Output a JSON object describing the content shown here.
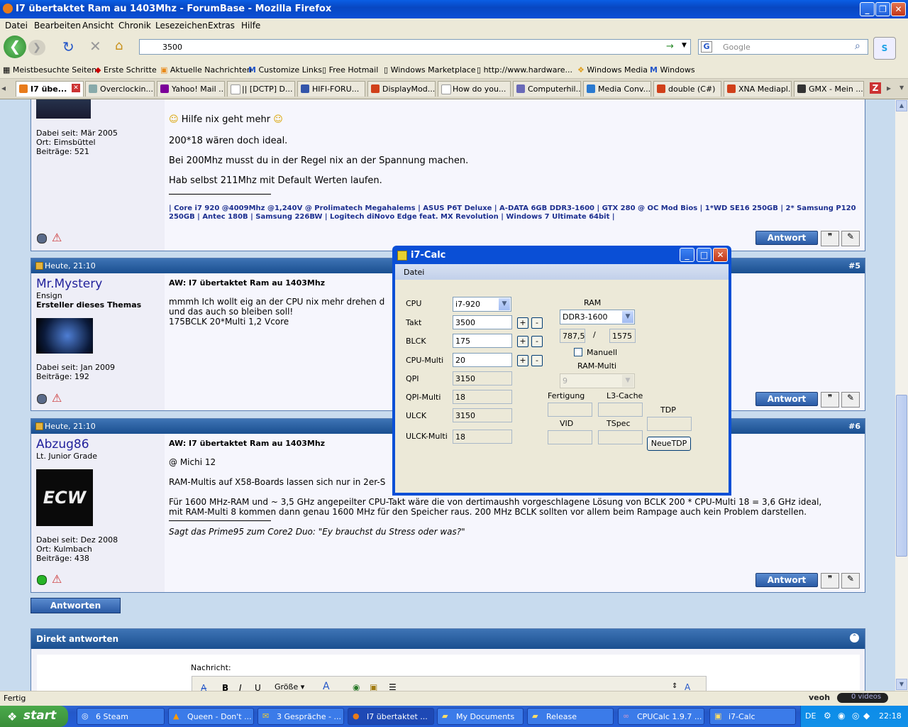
{
  "window": {
    "title": "I7 übertaktet Ram au 1403Mhz - ForumBase - Mozilla Firefox"
  },
  "menubar": [
    "Datei",
    "Bearbeiten",
    "Ansicht",
    "Chronik",
    "Lesezeichen",
    "Extras",
    "Hilfe"
  ],
  "nav": {
    "url": "3500",
    "search_placeholder": "Google"
  },
  "bookmarks": [
    "Meistbesuchte Seiten",
    "Erste Schritte",
    "Aktuelle Nachrichten",
    "Customize Links",
    "Free Hotmail",
    "Windows Marketplace",
    "http://www.hardware...",
    "Windows Media",
    "Windows"
  ],
  "tabs": [
    "I7 übe...",
    "Overclockin...",
    "Yahoo! Mail ...",
    "|| [DCTP] D...",
    "HIFI-FORU...",
    "DisplayMod...",
    "How do you...",
    "Computerhil...",
    "Media Conv...",
    "double (C#)",
    "XNA Mediapl...",
    "GMX - Mein ..."
  ],
  "post1": {
    "joined": "Dabei seit: Mär 2005",
    "location": "Ort: Eimsbüttel",
    "posts": "Beiträge: 521",
    "lines": [
      "Hilfe nix geht mehr",
      "200*18 wären doch ideal.",
      "Bei 200Mhz musst du in der Regel nix an der Spannung machen.",
      "Hab selbst 211Mhz mit Default Werten laufen."
    ],
    "signature": "| Core i7 920 @4009Mhz @1,240V @ Prolimatech Megahalems | ASUS P6T Deluxe | A-DATA 6GB DDR3-1600 | GTX 280 @ OC Mod Bios | 1*WD SE16 250GB | 2* Samsung P120 250GB | Antec 180B | Samsung 226BW | Logitech diNovo Edge feat. MX Revolution | Windows 7 Ultimate 64bit |"
  },
  "post2": {
    "date": "Heute, 21:10",
    "number": "#5",
    "user": "Mr.Mystery",
    "rank": "Ensign",
    "role": "Ersteller dieses Themas",
    "joined": "Dabei seit: Jan 2009",
    "posts": "Beiträge: 192",
    "subject": "AW: I7 übertaktet Ram au 1403Mhz",
    "lines": [
      "mmmh Ich wollt eig an der CPU nix mehr drehen d",
      "und das auch so bleiben soll!",
      "175BCLK 20*Multi 1,2 Vcore"
    ]
  },
  "post3": {
    "date": "Heute, 21:10",
    "number": "#6",
    "user": "Abzug86",
    "rank": "Lt. Junior Grade",
    "joined": "Dabei seit: Dez 2008",
    "location": "Ort: Kulmbach",
    "posts": "Beiträge: 438",
    "subject": "AW: I7 übertaktet Ram au 1403Mhz",
    "lines": [
      "@ Michi 12",
      "RAM-Multis auf X58-Boards lassen sich nur in 2er-S",
      "Für 1600 MHz-RAM und ~ 3,5 GHz angepeilter CPU-Takt wäre die von dertimaushh vorgeschlagene Lösung von BCLK 200 * CPU-Multi 18 = 3,6 GHz ideal,",
      "mit RAM-Multi 8 kommen dann genau 1600 MHz für den Speicher raus. 200 MHz BCLK sollten vor allem beim Rampage auch kein Problem darstellen."
    ],
    "signature": "Sagt das Prime95 zum Core2 Duo: \"Ey brauchst du Stress oder was?\""
  },
  "buttons": {
    "antwort": "Antwort",
    "antworten": "Antworten"
  },
  "quickreply": {
    "title": "Direkt antworten",
    "label": "Nachricht:",
    "size": "Größe"
  },
  "calc": {
    "title": "i7-Calc",
    "menu": "Datei",
    "cpu_label": "CPU",
    "cpu_value": "i7-920",
    "takt_label": "Takt",
    "takt_value": "3500",
    "bclk_label": "BLCK",
    "bclk_value": "175",
    "multi_label": "CPU-Multi",
    "multi_value": "20",
    "qpi_label": "QPI",
    "qpi_value": "3150",
    "qpimulti_label": "QPI-Multi",
    "qpimulti_value": "18",
    "ulck_label": "ULCK",
    "ulck_value": "3150",
    "ulckmulti_label": "ULCK-Multi",
    "ulckmulti_value": "18",
    "ram_label": "RAM",
    "ram_value": "DDR3-1600",
    "ram_a": "787,5",
    "ram_sep": "/",
    "ram_b": "1575",
    "manuell": "Manuell",
    "rammulti_label": "RAM-Multi",
    "rammulti_value": "9",
    "fertigung": "Fertigung",
    "l3cache": "L3-Cache",
    "tdp": "TDP",
    "vid": "VID",
    "tspec": "TSpec",
    "neuetdp": "NeueTDP",
    "plus": "+",
    "minus": "-"
  },
  "status": {
    "text": "Fertig",
    "videos": "0 videos"
  },
  "taskbar": {
    "start": "start",
    "tasks": [
      "6 Steam",
      "Queen - Don't ...",
      "3 Gespräche - ...",
      "I7 übertaktet ...",
      "My Documents",
      "Release",
      "CPUCalc 1.9.7 ...",
      "i7-Calc"
    ],
    "lang": "DE",
    "clock": "22:18"
  },
  "colors": {
    "xp_blue": "#0a4fd6",
    "forum_header": "#1a4f90",
    "forum_bg": "#c8dbee"
  }
}
